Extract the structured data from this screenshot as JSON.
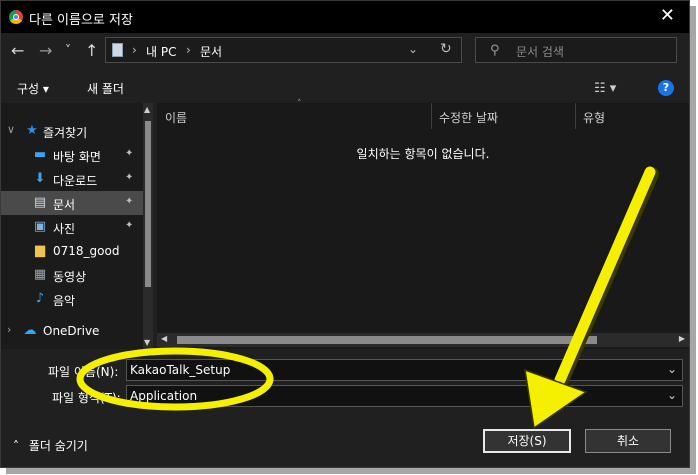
{
  "window": {
    "title": "다른 이름으로 저장",
    "close_glyph": "✕"
  },
  "nav": {
    "back_glyph": "←",
    "forward_glyph": "→",
    "recent_glyph": "˅",
    "up_glyph": "↑",
    "breadcrumb": [
      "내 PC",
      "문서"
    ],
    "separator": "›",
    "dropdown_glyph": "⌄",
    "refresh_glyph": "↻"
  },
  "search": {
    "placeholder": "문서 검색",
    "icon": "search-icon"
  },
  "toolbar": {
    "organize_label": "구성 ▾",
    "new_folder_label": "새 폴더",
    "view_glyph": "☷ ▾",
    "help_glyph": "?"
  },
  "sidebar": {
    "items": [
      {
        "label": "즐겨찾기",
        "icon": "star-icon",
        "glyph": "★",
        "color": "#2d8cf0",
        "expanded": true
      },
      {
        "label": "바탕 화면",
        "icon": "desktop-icon",
        "glyph": "▬",
        "color": "#3ba4f0",
        "pinned": true
      },
      {
        "label": "다운로드",
        "icon": "download-icon",
        "glyph": "⬇",
        "color": "#3ba4f0",
        "pinned": true
      },
      {
        "label": "문서",
        "icon": "document-icon",
        "glyph": "▤",
        "color": "#cfd8e3",
        "pinned": true,
        "selected": true
      },
      {
        "label": "사진",
        "icon": "picture-icon",
        "glyph": "▣",
        "color": "#7fb3e0",
        "pinned": true
      },
      {
        "label": "0718_good",
        "icon": "folder-icon",
        "glyph": "▆",
        "color": "#f0c454"
      },
      {
        "label": "동영상",
        "icon": "video-icon",
        "glyph": "▦",
        "color": "#9aa7b4"
      },
      {
        "label": "음악",
        "icon": "music-icon",
        "glyph": "♪",
        "color": "#3ba4f0"
      },
      {
        "label": "OneDrive",
        "icon": "cloud-icon",
        "glyph": "☁",
        "color": "#3ba4f0"
      }
    ],
    "pin_glyph": "📌"
  },
  "columns": [
    "이름",
    "수정한 날짜",
    "유형"
  ],
  "empty_message": "일치하는 항목이 없습니다.",
  "form": {
    "filename_label": "파일 이름(N):",
    "filename_value": "KakaoTalk_Setup",
    "filetype_label": "파일 형식(T):",
    "filetype_value": "Application",
    "hide_folders_label": "폴더 숨기기",
    "save_label": "저장(S)",
    "cancel_label": "취소"
  },
  "colors": {
    "annotation": "#f5f000",
    "accent": "#1a73e8"
  }
}
